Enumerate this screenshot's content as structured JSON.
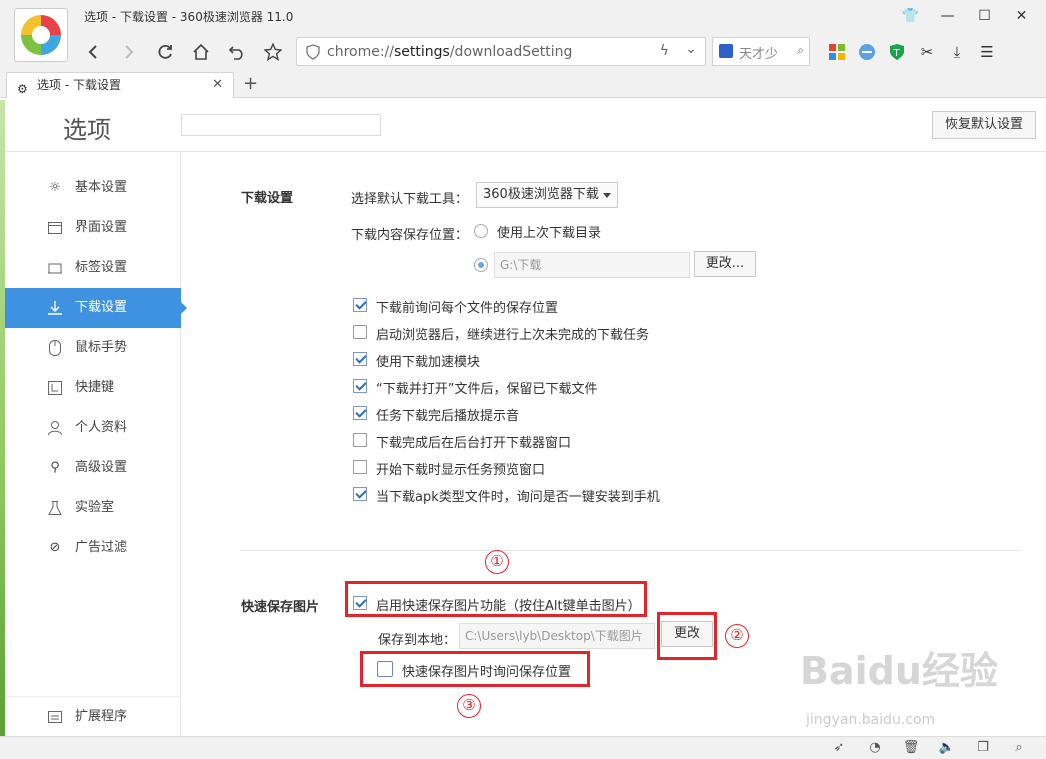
{
  "window": {
    "title": "选项 - 下载设置 - 360极速浏览器 11.0"
  },
  "address": {
    "prefix": "chrome://",
    "host": "settings",
    "path": "/downloadSetting"
  },
  "search_engine": {
    "placeholder": "天才少"
  },
  "tab": {
    "label": "选项 - 下载设置"
  },
  "header": {
    "title": "选项",
    "restore_label": "恢复默认设置"
  },
  "sidebar": {
    "items": [
      {
        "label": "基本设置",
        "icon": "sun-icon"
      },
      {
        "label": "界面设置",
        "icon": "window-icon"
      },
      {
        "label": "标签设置",
        "icon": "tab-icon"
      },
      {
        "label": "下载设置",
        "icon": "download-icon",
        "active": true
      },
      {
        "label": "鼠标手势",
        "icon": "mouse-icon"
      },
      {
        "label": "快捷键",
        "icon": "keyboard-icon"
      },
      {
        "label": "个人资料",
        "icon": "person-icon"
      },
      {
        "label": "高级设置",
        "icon": "wrench-icon"
      },
      {
        "label": "实验室",
        "icon": "flask-icon"
      },
      {
        "label": "广告过滤",
        "icon": "block-icon"
      }
    ],
    "extensions_label": "扩展程序"
  },
  "download": {
    "section_title": "下载设置",
    "tool_label": "选择默认下载工具：",
    "tool_value": "360极速浏览器下载",
    "save_location_label": "下载内容保存位置：",
    "radio_last": "使用上次下载目录",
    "path_value": "G:\\下载",
    "change_label": "更改...",
    "options": [
      {
        "label": "下载前询问每个文件的保存位置",
        "checked": true
      },
      {
        "label": "启动浏览器后，继续进行上次未完成的下载任务",
        "checked": false
      },
      {
        "label": "使用下载加速模块",
        "checked": true
      },
      {
        "label": "“下载并打开”文件后，保留已下载文件",
        "checked": true
      },
      {
        "label": "任务下载完后播放提示音",
        "checked": true
      },
      {
        "label": "下载完成后在后台打开下载器窗口",
        "checked": false
      },
      {
        "label": "开始下载时显示任务预览窗口",
        "checked": false
      },
      {
        "label": "当下载apk类型文件时，询问是否一键安装到手机",
        "checked": true
      }
    ]
  },
  "quick_save": {
    "section_title": "快速保存图片",
    "enable_label": "启用快速保存图片功能（按住Alt键单击图片）",
    "enable_checked": true,
    "local_label": "保存到本地：",
    "local_path": "C:\\Users\\lyb\\Desktop\\下载图片",
    "change_label": "更改",
    "ask_label": "快速保存图片时询问保存位置",
    "ask_checked": false
  },
  "annotations": {
    "one": "①",
    "two": "②",
    "three": "③"
  },
  "watermark": {
    "main": "Baidu经验",
    "sub": "jingyan.baidu.com"
  },
  "colors": {
    "accent": "#3e92e0",
    "annotation_red": "#e0262a"
  }
}
